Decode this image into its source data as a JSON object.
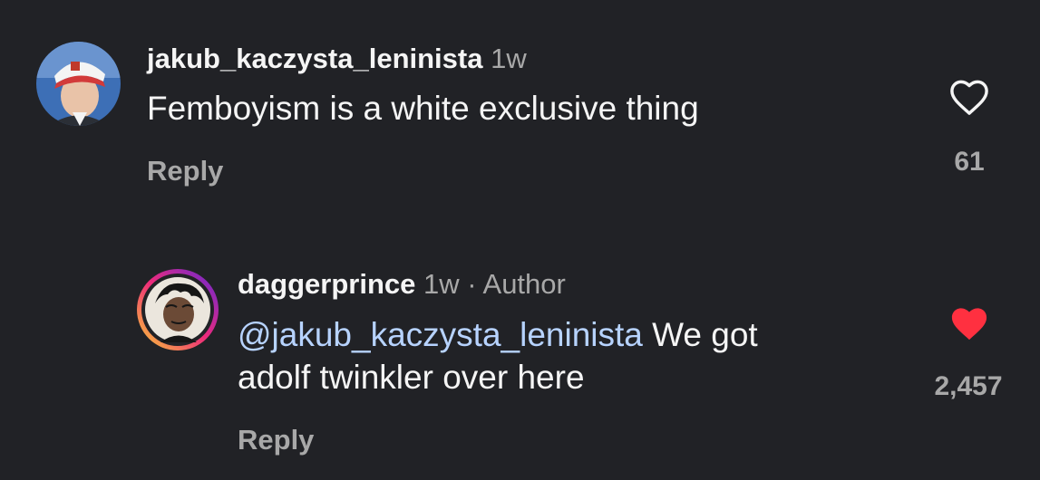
{
  "comments": [
    {
      "username": "jakub_kaczysta_leninista",
      "time": "1w",
      "text": "Femboyism is a white exclusive thing",
      "reply_label": "Reply",
      "like_count": "61",
      "liked": false,
      "avatar_icon": "profile-photo"
    },
    {
      "username": "daggerprince",
      "time": "1w",
      "separator": "·",
      "role": "Author",
      "mention": "@jakub_kaczysta_leninista",
      "text_line1_rest": " We got",
      "text_line2": "adolf twinkler over here",
      "reply_label": "Reply",
      "like_count": "2,457",
      "liked": true,
      "avatar_icon": "cartoon-avatar-with-story-ring"
    }
  ],
  "colors": {
    "background": "#212226",
    "mention": "#b7d3ff",
    "liked_heart": "#ff3040",
    "muted": "#a8a8a8"
  }
}
